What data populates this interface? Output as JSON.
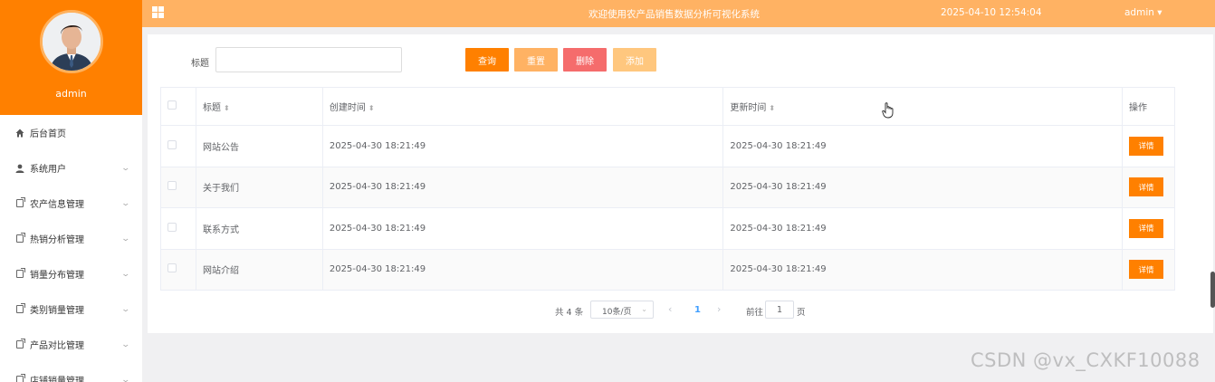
{
  "header": {
    "title": "欢迎使用农产品销售数据分析可视化系统",
    "datetime": "2025-04-10 12:54:04",
    "user_menu": "admin ▾"
  },
  "sidebar": {
    "username": "admin",
    "items": [
      {
        "label": "后台首页",
        "icon": "home-icon"
      },
      {
        "label": "系统用户",
        "icon": "user-icon"
      },
      {
        "label": "农产信息管理",
        "icon": "document-icon"
      },
      {
        "label": "热销分析管理",
        "icon": "document-icon"
      },
      {
        "label": "销量分布管理",
        "icon": "document-icon"
      },
      {
        "label": "类别销量管理",
        "icon": "document-icon"
      },
      {
        "label": "产品对比管理",
        "icon": "document-icon"
      },
      {
        "label": "店铺销量管理",
        "icon": "document-icon"
      }
    ],
    "accent_color": "#ff8000"
  },
  "search": {
    "label": "标题",
    "value": "",
    "placeholder": ""
  },
  "toolbar": {
    "query_label": "查询",
    "reset_label": "重置",
    "delete_label": "删除",
    "add_label": "添加",
    "colors": {
      "query": "#ff8000",
      "reset": "#ffb263",
      "delete": "#f56c6c",
      "add": "#ffc77e"
    }
  },
  "table": {
    "columns": [
      "标题",
      "创建时间",
      "更新时间",
      "操作"
    ],
    "rows": [
      {
        "title": "网站公告",
        "created": "2025-04-30 18:21:49",
        "updated": "2025-04-30 18:21:49",
        "action": "详情"
      },
      {
        "title": "关于我们",
        "created": "2025-04-30 18:21:49",
        "updated": "2025-04-30 18:21:49",
        "action": "详情"
      },
      {
        "title": "联系方式",
        "created": "2025-04-30 18:21:49",
        "updated": "2025-04-30 18:21:49",
        "action": "详情"
      },
      {
        "title": "网站介绍",
        "created": "2025-04-30 18:21:49",
        "updated": "2025-04-30 18:21:49",
        "action": "详情"
      }
    ]
  },
  "pagination": {
    "total": "共 4 条",
    "page_size": "10条/页",
    "current": "1",
    "goto_label": "前往",
    "goto_value": "1",
    "page_suffix": "页"
  },
  "watermark": "CSDN @vx_CXKF10088"
}
